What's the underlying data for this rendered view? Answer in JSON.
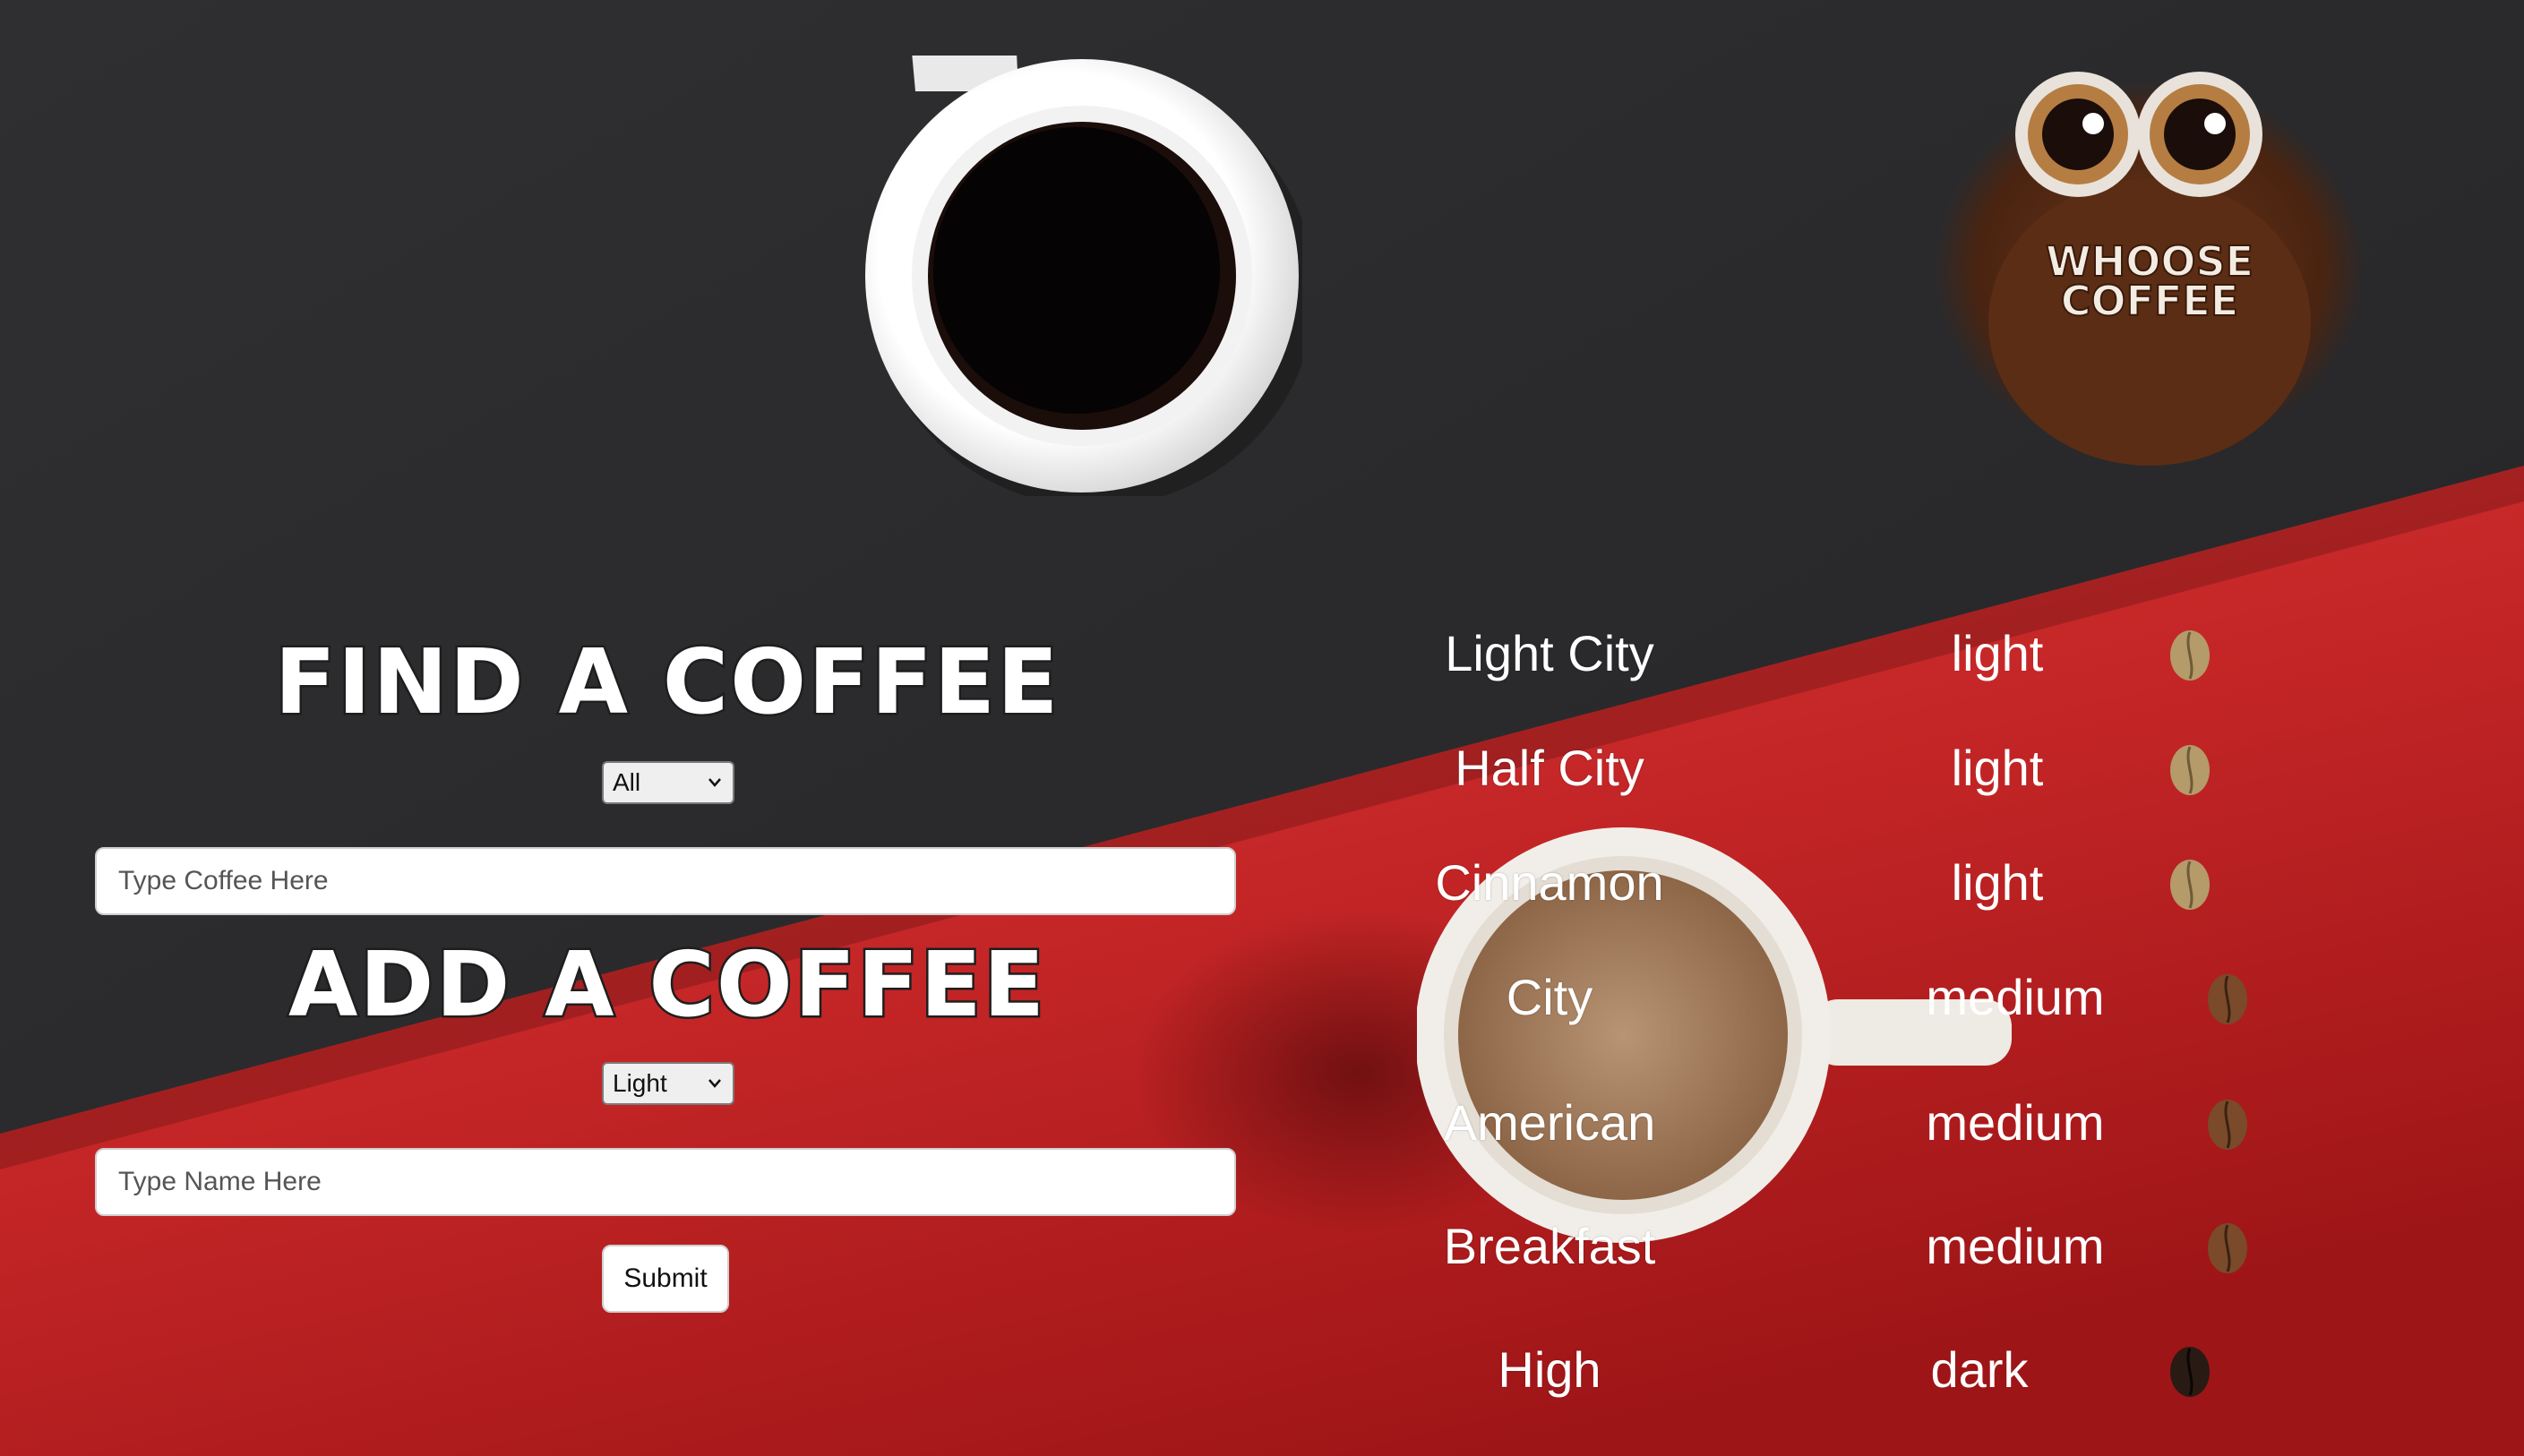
{
  "colors": {
    "dark_bg": "#2b2b2d",
    "red_bg": "#c8282a",
    "heading_text": "#ffffff",
    "list_text": "#ffffff"
  },
  "logo": {
    "line1": "WHOOSE",
    "line2": "COFFEE"
  },
  "find": {
    "heading": "FIND A COFFEE",
    "select_value": "All",
    "input_placeholder": "Type Coffee Here"
  },
  "add": {
    "heading": "ADD A COFFEE",
    "select_value": "Light",
    "input_placeholder": "Type Name Here",
    "submit_label": "Submit"
  },
  "coffees": [
    {
      "name": "Light City",
      "roast": "light",
      "bean_icon": "light-bean-icon"
    },
    {
      "name": "Half City",
      "roast": "light",
      "bean_icon": "light-bean-icon"
    },
    {
      "name": "Cinnamon",
      "roast": "light",
      "bean_icon": "light-bean-icon"
    },
    {
      "name": "City",
      "roast": "medium",
      "bean_icon": "medium-bean-icon"
    },
    {
      "name": "American",
      "roast": "medium",
      "bean_icon": "medium-bean-icon"
    },
    {
      "name": "Breakfast",
      "roast": "medium",
      "bean_icon": "medium-bean-icon"
    },
    {
      "name": "High",
      "roast": "dark",
      "bean_icon": "dark-bean-icon"
    }
  ]
}
